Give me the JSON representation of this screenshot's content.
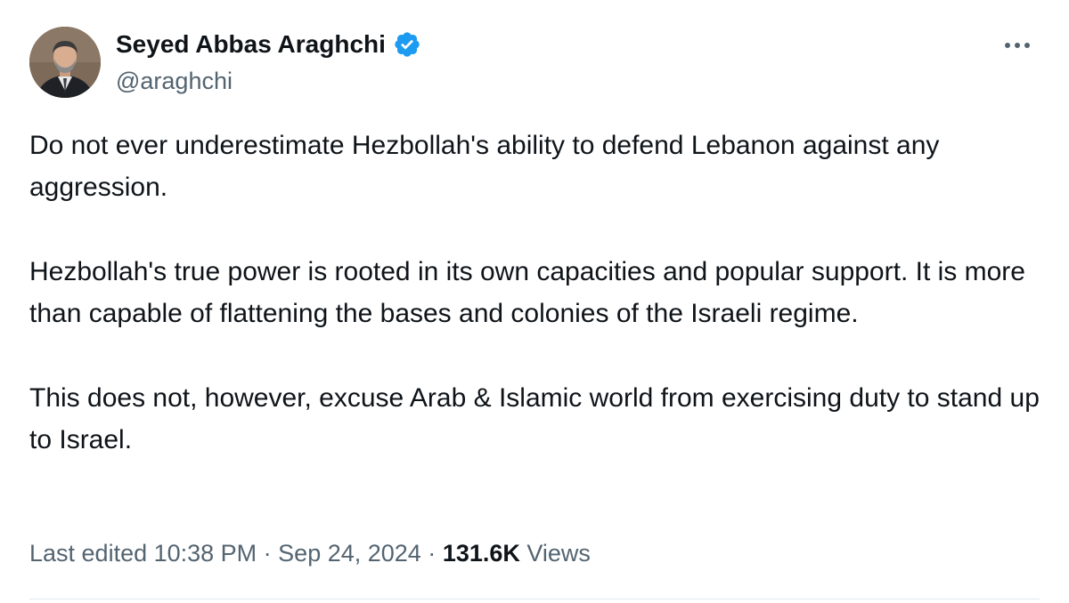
{
  "author": {
    "display_name": "Seyed Abbas Araghchi",
    "handle": "@araghchi",
    "verified": true
  },
  "tweet": {
    "paragraphs": [
      "Do not ever underestimate Hezbollah's ability to defend Lebanon against any aggression.",
      "Hezbollah's true power is rooted in its own capacities and popular support. It is more than capable of flattening the bases and colonies of the Israeli regime.",
      "This does not, however, excuse Arab & Islamic world from exercising duty to stand up to Israel."
    ]
  },
  "meta": {
    "edited": "Last edited 10:38 PM · Sep 24, 2024 · ",
    "views_count": "131.6K",
    "views_label": " Views"
  },
  "colors": {
    "verified_blue": "#1d9bf0",
    "secondary_text": "#536471",
    "primary_text": "#0f1419"
  },
  "icons": {
    "verified": "verified-badge-icon",
    "more": "more-options-icon"
  }
}
